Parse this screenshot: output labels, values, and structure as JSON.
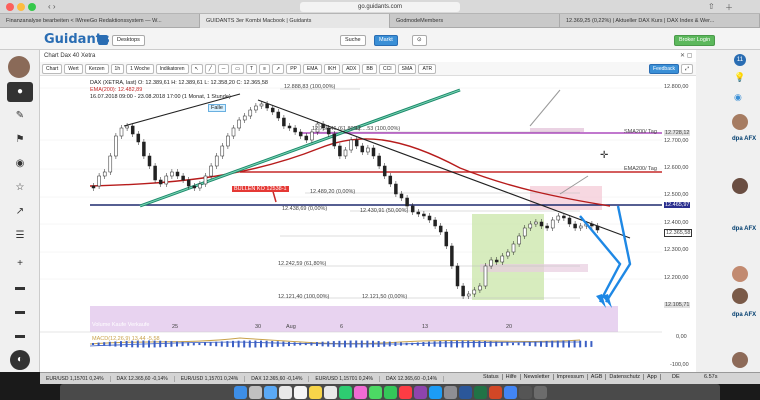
{
  "browser": {
    "url": "go.guidants.com",
    "tabs": [
      {
        "label": "Finanzanalyse bearbeiten < IWreeGo Redaktionssystem — W..."
      },
      {
        "label": "GUIDANTS 3er Kombi Macbook | Guidants",
        "active": true
      },
      {
        "label": "GodmodeMembers"
      },
      {
        "label": "12.369,25 (0,22%) | Aktueller DAX Kurs | DAX Index & Wer..."
      }
    ]
  },
  "app": {
    "logo": "Guidants",
    "desktops_label": "Desktops",
    "search_label": "Suche",
    "markt_label": "Markt",
    "broker_login": "Broker Login"
  },
  "toolbar": {
    "chart": "Chart",
    "wert": "Wert",
    "kerzen": "Kerzen",
    "interval": "1h",
    "range": "1 Woche",
    "indikatoren": "Indikatoren",
    "pp": "PP",
    "ema": "EMA",
    "ikh": "IKH",
    "adx": "ADX",
    "bb": "BB",
    "cci": "CCI",
    "sma": "SMA",
    "atr": "ATR",
    "feedback": "Feedback"
  },
  "chart_header": {
    "title": "Chart Dax 40 Xetra",
    "line1": "DAX (XETRA, last)  O: 12.389,61  H: 12.389,61  L: 12.358,20  C: 12.365,58",
    "line2": "EMA(200): 12.482,89",
    "line3": "16.07.2018 09:00 - 23.08.2018 17:00  (1 Monat, 1 Stunde)",
    "fallen_label": "Falle"
  },
  "annotations": {
    "fib_top": "12.888,83 (100,00%)",
    "fib_1": "12.736,46 (61,80%)",
    "fib_1b": "12....53 (100,00%)",
    "fib_2": "12.489,20 (0,00%)",
    "fib_3": "12.438,69 (0,00%)",
    "fib_4": "12.430,91 (50,00%)",
    "fib_5": "12.242,59 (61,80%)",
    "fib_6": "12.121,40 (100,00%)",
    "fib_7": "12.121,50 (0,00%)",
    "bullen": "BULLEN KO 12538-1",
    "sma200": "SMA200/ Tag",
    "ema200": "EMA200/ Tag",
    "volume_label": "Volume Kaufe Verkaufe"
  },
  "price_axis": {
    "labels": [
      "12.800,00",
      "12.728,12",
      "12.700,00",
      "12.600,00",
      "12.500,00",
      "12.465,97",
      "12.400,00",
      "12.365,58",
      "12.300,00",
      "12.200,00",
      "12.105,71"
    ],
    "highlights": {
      "12.465,97": "#2a2f8f",
      "12.365,58": "#ffffff",
      "12.728,12": "#e0e0e0",
      "12.105,71": "#e0e0e0"
    }
  },
  "date_axis": [
    "25",
    "30",
    "Aug",
    "6",
    "13",
    "20"
  ],
  "macd": {
    "label": "MACD(12,26,9)  13,44  -5,58",
    "axis": [
      "0,00",
      "-100,00"
    ]
  },
  "ticker": [
    "EUR/USD 1,15701 0,24%",
    "DAX 12.365,60 -0,14%",
    "EUR/USD 1,15701 0,24%",
    "DAX 12.365,60 -0,14%",
    "EUR/USD 1,15701 0,24%",
    "DAX 12.365,60 -0,14%"
  ],
  "status_links": [
    "Status",
    "Hilfe",
    "Newsletter",
    "Impressum",
    "AGB",
    "Datenschutz",
    "App"
  ],
  "status_right": "6.57s",
  "status_de": "DE",
  "sidebar_right": {
    "badge": "11",
    "dpa1": "dpa AFX",
    "dpa2": "dpa AFX",
    "dpa3": "dpa AFX"
  },
  "colors": {
    "brand": "#2a6db3",
    "ema": "#c62828",
    "sma": "#7b1fa2",
    "green_trend": "#1b8a6b",
    "navy_line": "#1f2a6e",
    "blue_arrow": "#1e88e5"
  }
}
